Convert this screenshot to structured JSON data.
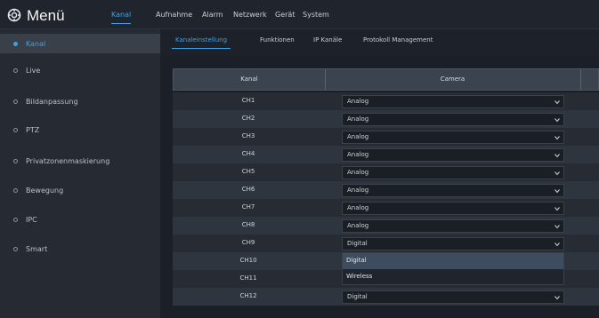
{
  "header": {
    "title": "Menü",
    "tabs": [
      {
        "label": "Kanal",
        "active": true
      },
      {
        "label": "Aufnahme",
        "active": false
      },
      {
        "label": "Alarm",
        "active": false
      },
      {
        "label": "Netzwerk",
        "active": false
      },
      {
        "label": "Gerät",
        "active": false
      },
      {
        "label": "System",
        "active": false
      }
    ]
  },
  "sidebar": {
    "items": [
      {
        "label": "Kanal",
        "active": true
      },
      {
        "label": "Live",
        "active": false
      },
      {
        "label": "Bildanpassung",
        "active": false
      },
      {
        "label": "PTZ",
        "active": false
      },
      {
        "label": "Privatzonenmaskierung",
        "active": false
      },
      {
        "label": "Bewegung",
        "active": false
      },
      {
        "label": "IPC",
        "active": false
      },
      {
        "label": "Smart",
        "active": false
      }
    ]
  },
  "subtabs": [
    {
      "label": "Kanaleinstellung",
      "active": true
    },
    {
      "label": "Funktionen",
      "active": false
    },
    {
      "label": "IP Kanäle",
      "active": false
    },
    {
      "label": "Protokoll Management",
      "active": false
    }
  ],
  "table": {
    "columns": [
      "Kanal",
      "Camera"
    ],
    "rows": [
      {
        "channel": "CH1",
        "mode": "Analog"
      },
      {
        "channel": "CH2",
        "mode": "Analog"
      },
      {
        "channel": "CH3",
        "mode": "Analog"
      },
      {
        "channel": "CH4",
        "mode": "Analog"
      },
      {
        "channel": "CH5",
        "mode": "Analog"
      },
      {
        "channel": "CH6",
        "mode": "Analog"
      },
      {
        "channel": "CH7",
        "mode": "Analog"
      },
      {
        "channel": "CH8",
        "mode": "Analog"
      },
      {
        "channel": "CH9",
        "mode": "Digital"
      },
      {
        "channel": "CH10",
        "mode": ""
      },
      {
        "channel": "CH11",
        "mode": ""
      },
      {
        "channel": "CH12",
        "mode": "Digital"
      }
    ]
  },
  "dropdown": {
    "options": [
      "Digital",
      "Wireless"
    ],
    "selected": "Digital"
  },
  "colors": {
    "accent": "#3da2e6",
    "background": "#1b1f27",
    "sidebar": "#262b33",
    "header_row": "#3b434e"
  },
  "icons": {
    "logo": "gear-icon",
    "select": "chevron-down-icon"
  }
}
